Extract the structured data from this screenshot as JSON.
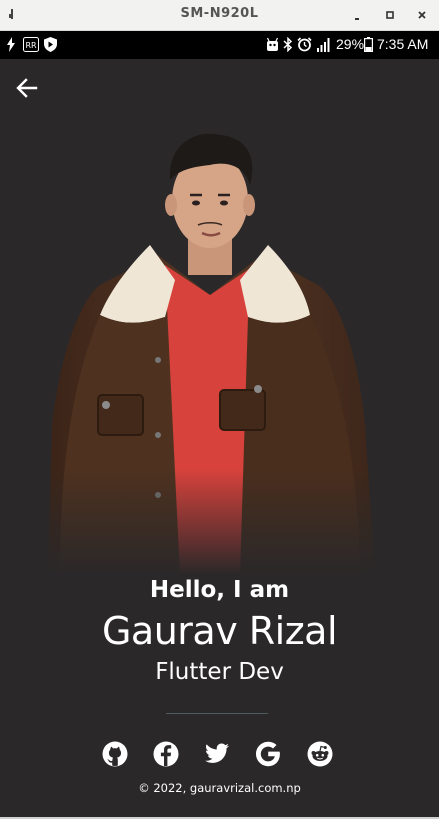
{
  "window": {
    "title": "SM-N920L"
  },
  "status_bar": {
    "battery_percent": "29%",
    "time": "7:35 AM",
    "icons": [
      "flash-icon",
      "rr-icon",
      "shield-icon",
      "android-icon",
      "bluetooth-icon",
      "alarm-icon",
      "signal-icon",
      "battery-icon"
    ]
  },
  "profile": {
    "greeting": "Hello, I am",
    "name": "Gaurav Rizal",
    "role": "Flutter Dev"
  },
  "social_links": [
    "github-icon",
    "facebook-icon",
    "twitter-icon",
    "google-icon",
    "reddit-icon"
  ],
  "footer": {
    "copyright": "© 2022, gauravrizal.com.np"
  },
  "colors": {
    "background": "#2a2829",
    "text": "#ffffff",
    "divider": "#4d5b5c",
    "jacket": "#4a2f1f",
    "shirt": "#d8423c"
  }
}
